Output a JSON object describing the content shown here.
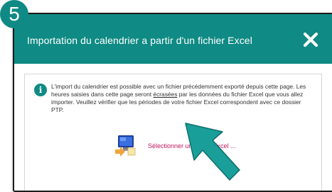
{
  "step_badge": "5",
  "dialog": {
    "title": "Importation du calendrier a partir d'un fichier Excel",
    "close_icon": "close-icon"
  },
  "info": {
    "icon": "info-icon",
    "icon_glyph": "i",
    "text_before": "L'import du calendrier est possible avec un fichier précédemment exporté depuis cette page. Les heures saisies dans cette page seront ",
    "text_emphasis": "écrasées",
    "text_after": " par les données du fichier Excel que vous allez importer. Veuillez vérifier que les périodes de votre fichier Excel correspondent avec ce dossier PTP."
  },
  "import": {
    "icon": "import-excel-icon",
    "label": "Sélectionner un fichier Excel ..."
  },
  "colors": {
    "accent": "#0f8a84",
    "link": "#c2185b",
    "pointer": "#1a9e9a"
  },
  "pointer_icon": "pointer-arrow-icon"
}
